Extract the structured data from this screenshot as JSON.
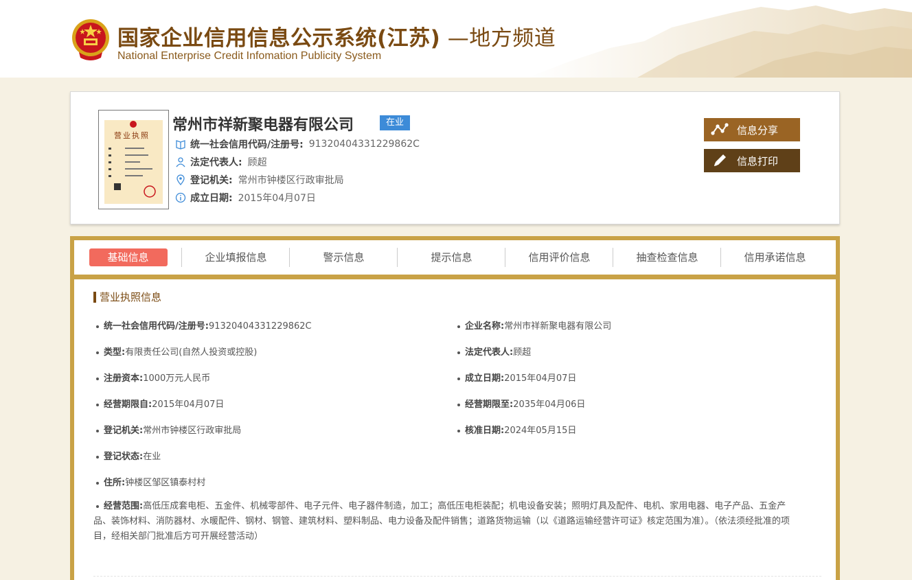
{
  "header": {
    "title_main": "国家企业信用信息公示系统(江苏)",
    "title_suffix": " —地方频道",
    "title_en": "National Enterprise Credit Infomation Publicity System"
  },
  "company": {
    "name": "常州市祥新聚电器有限公司",
    "status": "在业",
    "license_label": "营业执照",
    "code_label": "统一社会信用代码/注册号:",
    "code_value": "91320404331229862C",
    "rep_label": "法定代表人:",
    "rep_value": "顾超",
    "authority_label": "登记机关:",
    "authority_value": "常州市钟楼区行政审批局",
    "date_label": "成立日期:",
    "date_value": "2015年04月07日"
  },
  "actions": {
    "share_label": "信息分享",
    "print_label": "信息打印"
  },
  "tabs": [
    "基础信息",
    "企业填报信息",
    "警示信息",
    "提示信息",
    "信用评价信息",
    "抽查检查信息",
    "信用承诺信息"
  ],
  "section": {
    "title": "营业执照信息"
  },
  "fields": {
    "code": {
      "label": "统一社会信用代码/注册号:",
      "value": "91320404331229862C"
    },
    "name": {
      "label": "企业名称:",
      "value": "常州市祥新聚电器有限公司"
    },
    "type": {
      "label": "类型:",
      "value": "有限责任公司(自然人投资或控股)"
    },
    "rep": {
      "label": "法定代表人:",
      "value": "顾超"
    },
    "capital": {
      "label": "注册资本:",
      "value": "1000万元人民币"
    },
    "founded": {
      "label": "成立日期:",
      "value": "2015年04月07日"
    },
    "term_from": {
      "label": "经营期限自:",
      "value": "2015年04月07日"
    },
    "term_to": {
      "label": "经营期限至:",
      "value": "2035年04月06日"
    },
    "authority": {
      "label": "登记机关:",
      "value": "常州市钟楼区行政审批局"
    },
    "approved": {
      "label": "核准日期:",
      "value": "2024年05月15日"
    },
    "reg_status": {
      "label": "登记状态:",
      "value": "在业"
    },
    "address": {
      "label": "住所:",
      "value": "钟楼区邹区镇泰村村"
    },
    "scope": {
      "label": "经营范围:",
      "value": "高低压成套电柜、五金件、机械零部件、电子元件、电子器件制造，加工；高低压电柜装配；机电设备安装；照明灯具及配件、电机、家用电器、电子产品、五金产品、装饰材料、消防器材、水暖配件、钢材、钢管、建筑材料、塑料制品、电力设备及配件销售；道路货物运输（以《道路运输经营许可证》核定范围为准）。（依法须经批准的项目，经相关部门批准后方可开展经营活动）"
    }
  },
  "colors": {
    "brand_brown": "#7a4a12",
    "status_blue": "#3d8bd8",
    "active_tab": "#f26a5d",
    "frame_gold": "#c9a246",
    "share_button": "#9a6424",
    "print_button": "#5f4018"
  }
}
